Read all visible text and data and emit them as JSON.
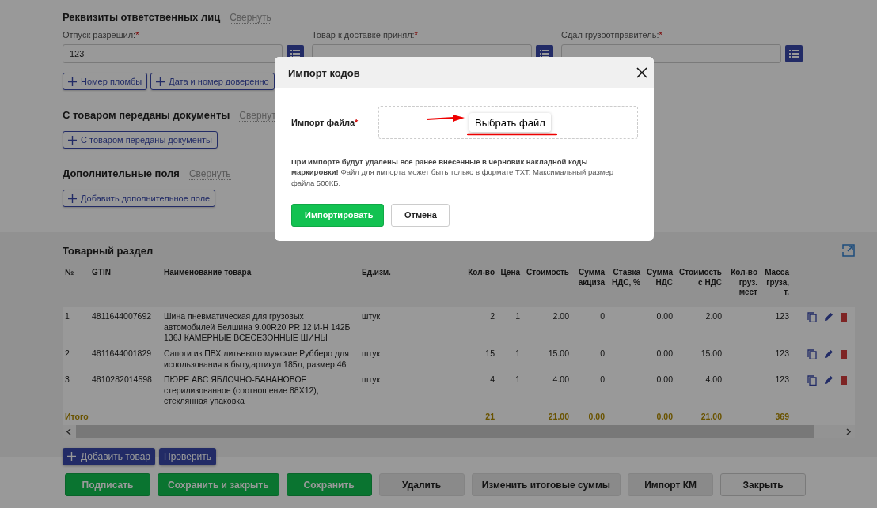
{
  "responsible_persons": {
    "title": "Реквизиты ответственных лиц",
    "collapse": "Свернуть",
    "fields": [
      {
        "label": "Отпуск разрешил:",
        "required_mark": "*",
        "value": "123"
      },
      {
        "label": "Товар к доставке принял:",
        "required_mark": "*"
      },
      {
        "label": "Сдал грузоотправитель:",
        "required_mark": "*"
      }
    ],
    "add_buttons": [
      "Номер пломбы",
      "Дата и номер доверенно"
    ]
  },
  "documents": {
    "title": "С товаром переданы документы",
    "collapse": "Свернут",
    "add_buttons": [
      "С товаром переданы документы"
    ]
  },
  "extra_fields": {
    "title": "Дополнительные поля",
    "collapse": "Свернуть",
    "add_buttons": [
      "Добавить дополнительное поле"
    ]
  },
  "goods": {
    "title": "Товарный раздел",
    "columns": [
      "№",
      "GTIN",
      "Наименование товара",
      "Ед.изм.",
      "Кол-во",
      "Цена",
      "Стоимость",
      "Сумма акциза",
      "Ставка НДС, %",
      "Сумма НДС",
      "Стоимость с НДС",
      "Кол-во груз. мест",
      "Масса груза, т."
    ],
    "rows": [
      {
        "cells": [
          "1",
          "4811644007692",
          "Шина пневматическая для грузовых автомобилей Белшина 9.00R20 PR 12 И-Н 142Б 136J КАМЕРНЫЕ ВСЕСЕЗОННЫЕ ШИНЫ",
          "штук",
          "2",
          "1",
          "2.00",
          "0",
          null,
          "0.00",
          "2.00",
          null,
          "123"
        ]
      },
      {
        "cells": [
          "2",
          "4811644001829",
          "Сапоги из ПВХ литьевого мужские Рубберо для использования в быту,артикул 185л, размер 46",
          "штук",
          "15",
          "1",
          "15.00",
          "0",
          null,
          "0.00",
          "15.00",
          null,
          "123"
        ]
      },
      {
        "cells": [
          "3",
          "4810282014598",
          "ПЮРЕ АВС ЯБЛОЧНО-БАНАНОВОЕ стерилизованное (соотношение 88Х12), стеклянная упаковка",
          "штук",
          "4",
          "1",
          "4.00",
          "0",
          null,
          "0.00",
          "4.00",
          null,
          "123"
        ]
      }
    ],
    "totals": {
      "label": "Итого",
      "cells": [
        null,
        null,
        null,
        null,
        "21",
        null,
        "21.00",
        "0.00",
        null,
        "0.00",
        "21.00",
        null,
        "369"
      ]
    },
    "buttons": [
      {
        "label": "Добавить товар",
        "plus": true
      },
      {
        "label": "Проверить",
        "plus": false
      }
    ]
  },
  "footer_buttons": [
    {
      "label": "Подписать",
      "kind": "primary"
    },
    {
      "label": "Сохранить и закрыть",
      "kind": "primary"
    },
    {
      "label": "Сохранить",
      "kind": "primary"
    },
    {
      "label": "Удалить",
      "kind": "secondary"
    },
    {
      "label": "Изменить итоговые суммы",
      "kind": "secondary"
    },
    {
      "label": "Импорт КМ",
      "kind": "secondary"
    },
    {
      "label": "Закрыть",
      "kind": "outline"
    }
  ],
  "modal": {
    "title": "Импорт кодов",
    "file_label": "Импорт файла",
    "required_mark": "*",
    "choose_button": "Выбрать файл",
    "note": "**При импорте будут удалены все ранее внесённые в черновик накладной коды маркировки!** Файл для импорта может быть только в формате TXT. Максимальный размер файла 500КБ.",
    "buttons": [
      {
        "label": "Импортировать",
        "kind": "primary"
      },
      {
        "label": "Отмена",
        "kind": "outline"
      }
    ]
  }
}
